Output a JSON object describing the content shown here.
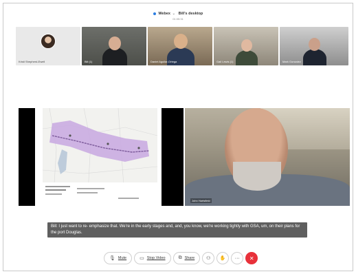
{
  "header": {
    "app_name": "Webex",
    "caret": "⌄",
    "desktop_label": "Bill's desktop",
    "timer": "01:05:31"
  },
  "participants": [
    {
      "name": "Kristi Shepherd-Ewell"
    },
    {
      "name": "Bill (1)"
    },
    {
      "name": "Daniel Aguilar-Ortega"
    },
    {
      "name": "Gail Lewis (1)"
    },
    {
      "name": "Mark Gonzalez"
    }
  ],
  "stage": {
    "speaker_name": "John Hartsfield",
    "map_notes": "Seleccione el ferrocarril"
  },
  "caption": {
    "text": "Bill: I just want to re- emphasize that. We're in the early stages and, and, you know, we're working tightly with GSA, um, on their plans for the port Douglas."
  },
  "controls": {
    "mute_label": "Mute",
    "stop_video_label": "Stop Video",
    "share_label": "Share",
    "more_glyph": "···",
    "end_glyph": "✕"
  },
  "icons": {
    "mute": "microphone-icon",
    "video": "camera-icon",
    "share": "share-screen-icon",
    "apps": "apps-icon",
    "reactions": "hand-icon"
  },
  "colors": {
    "accent": "#2a7de1",
    "end_call": "#e8313a",
    "caption_bg": "#5f5f5f",
    "map_region": "#c8a8e0"
  }
}
